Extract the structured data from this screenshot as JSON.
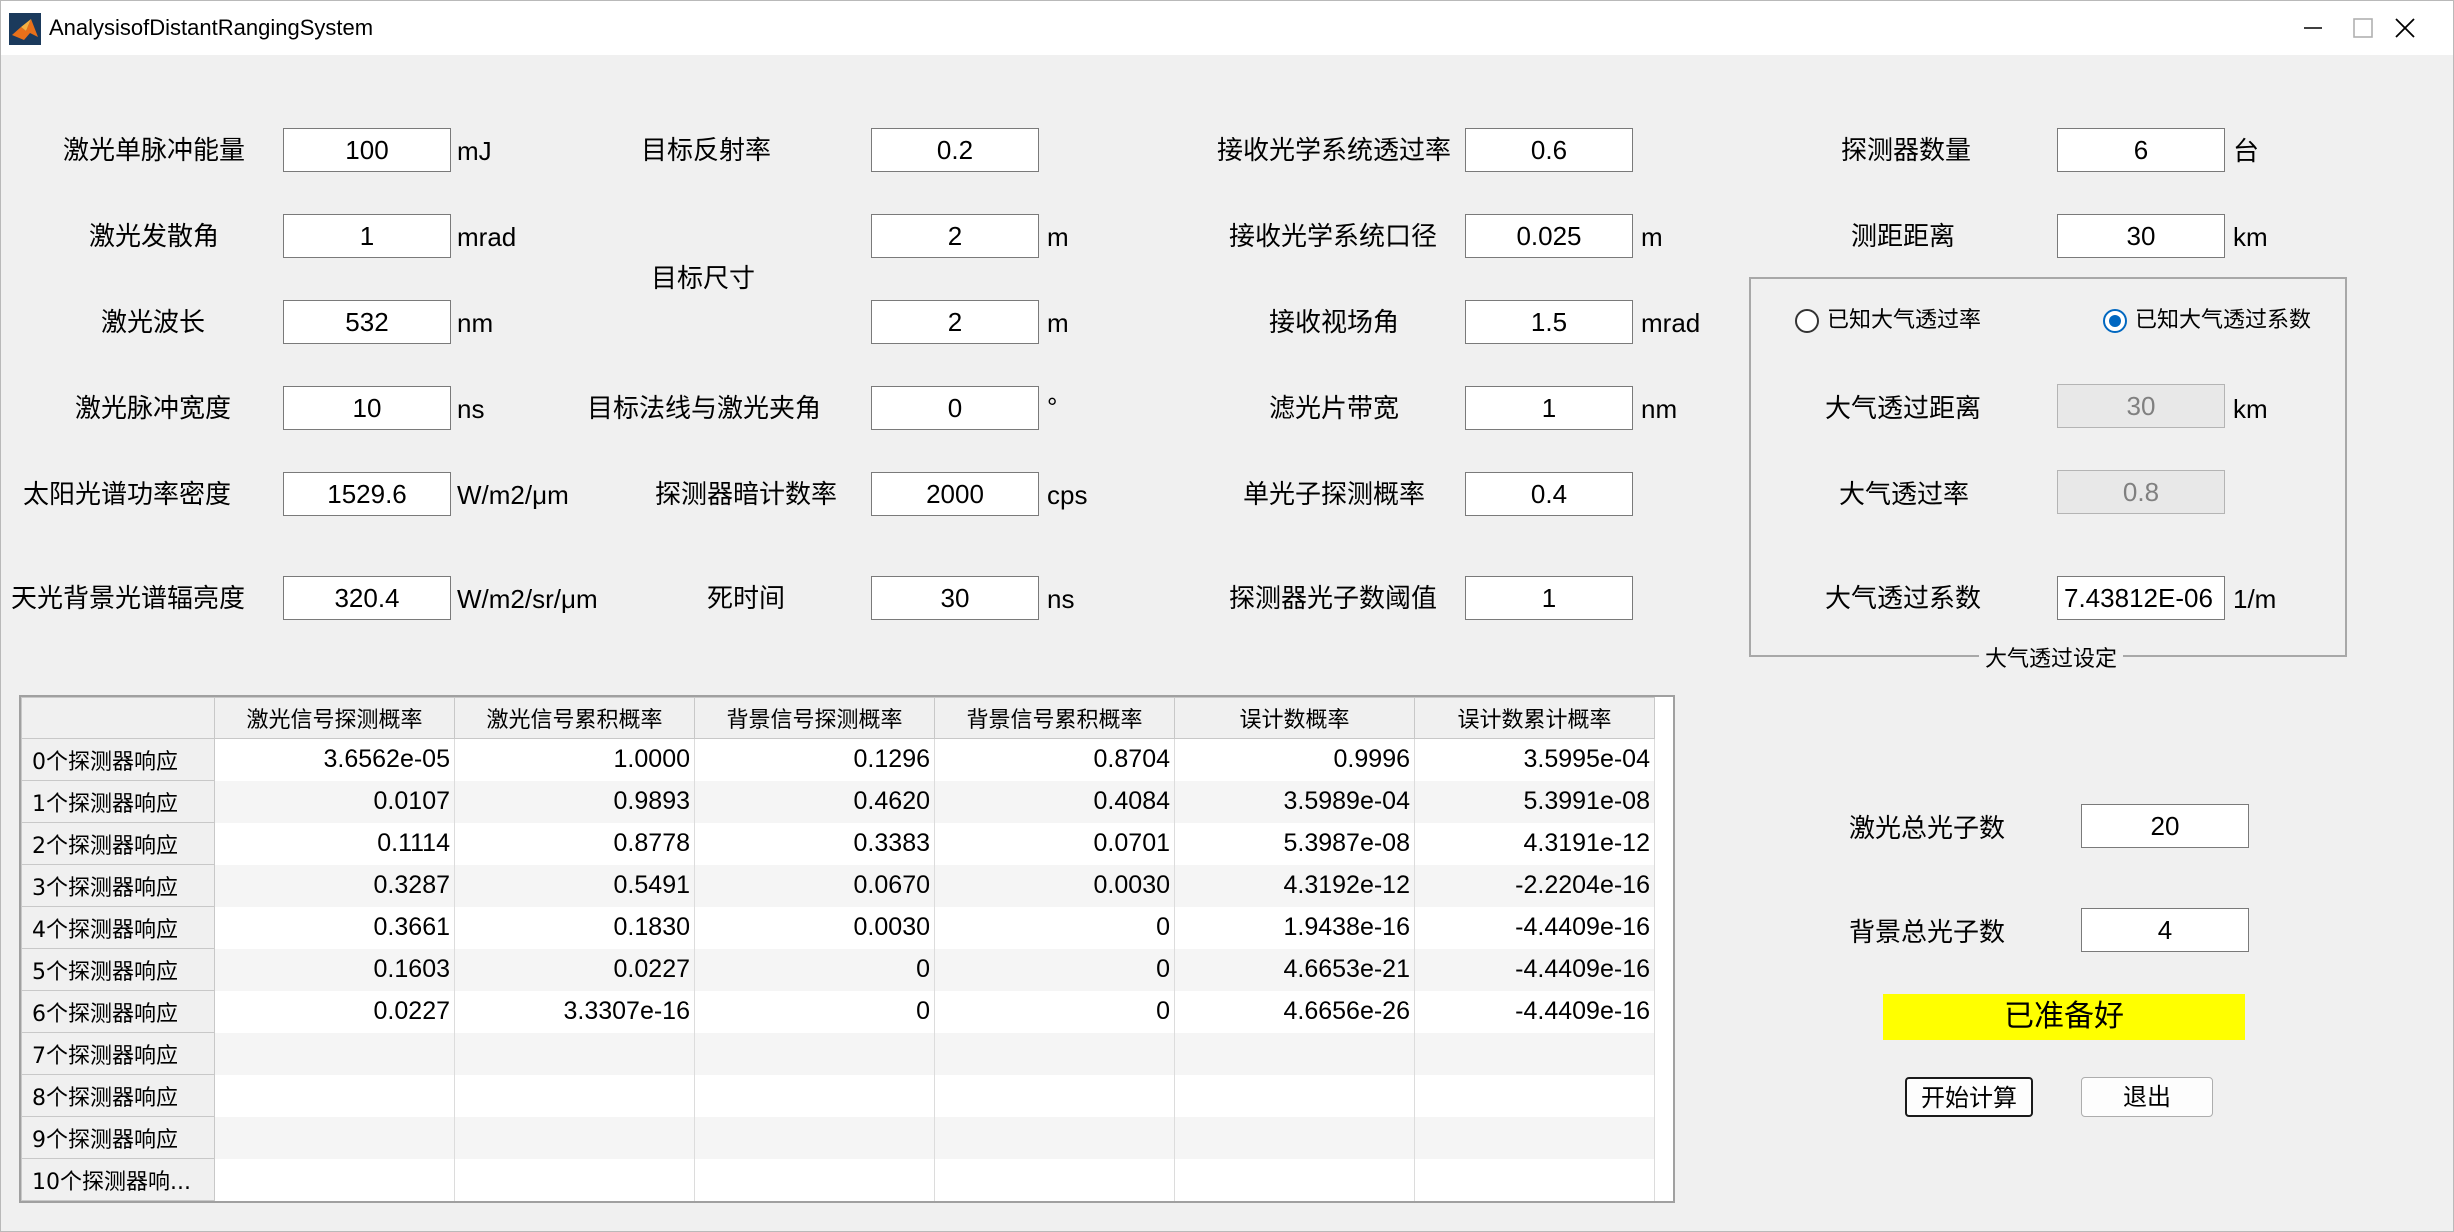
{
  "window": {
    "title": "AnalysisofDistantRangingSystem"
  },
  "params": {
    "laser_energy": {
      "label": "激光单脉冲能量",
      "value": "100",
      "unit": "mJ"
    },
    "divergence": {
      "label": "激光发散角",
      "value": "1",
      "unit": "mrad"
    },
    "wavelength": {
      "label": "激光波长",
      "value": "532",
      "unit": "nm"
    },
    "pulse_width": {
      "label": "激光脉冲宽度",
      "value": "10",
      "unit": "ns"
    },
    "solar_density": {
      "label": "太阳光谱功率密度",
      "value": "1529.6",
      "unit": "W/m2/μm"
    },
    "sky_radiance": {
      "label": "天光背景光谱辐亮度",
      "value": "320.4",
      "unit": "W/m2/sr/μm"
    },
    "target_reflectance": {
      "label": "目标反射率",
      "value": "0.2"
    },
    "target_size": {
      "label": "目标尺寸",
      "value1": "2",
      "unit1": "m",
      "value2": "2",
      "unit2": "m"
    },
    "target_angle": {
      "label": "目标法线与激光夹角",
      "value": "0",
      "unit": "°"
    },
    "dark_count": {
      "label": "探测器暗计数率",
      "value": "2000",
      "unit": "cps"
    },
    "dead_time": {
      "label": "死时间",
      "value": "30",
      "unit": "ns"
    },
    "rx_transmittance": {
      "label": "接收光学系统透过率",
      "value": "0.6"
    },
    "rx_aperture": {
      "label": "接收光学系统口径",
      "value": "0.025",
      "unit": "m"
    },
    "rx_fov": {
      "label": "接收视场角",
      "value": "1.5",
      "unit": "mrad"
    },
    "filter_bw": {
      "label": "滤光片带宽",
      "value": "1",
      "unit": "nm"
    },
    "single_photon_prob": {
      "label": "单光子探测概率",
      "value": "0.4"
    },
    "photon_threshold": {
      "label": "探测器光子数阈值",
      "value": "1"
    },
    "detector_count": {
      "label": "探测器数量",
      "value": "6",
      "unit": "台"
    },
    "range": {
      "label": "测距距离",
      "value": "30",
      "unit": "km"
    }
  },
  "atmosphere": {
    "group_title": "大气透过设定",
    "radio_transmittance": "已知大气透过率",
    "radio_coefficient": "已知大气透过系数",
    "selected": "coefficient",
    "distance": {
      "label": "大气透过距离",
      "value": "30",
      "unit": "km"
    },
    "transmittance": {
      "label": "大气透过率",
      "value": "0.8"
    },
    "coefficient": {
      "label": "大气透过系数",
      "value": "7.43812E-06",
      "unit": "1/m"
    }
  },
  "results_table": {
    "columns": [
      "激光信号探测概率",
      "激光信号累积概率",
      "背景信号探测概率",
      "背景信号累积概率",
      "误计数概率",
      "误计数累计概率"
    ],
    "rows": [
      {
        "head": "0个探测器响应",
        "cells": [
          "3.6562e-05",
          "1.0000",
          "0.1296",
          "0.8704",
          "0.9996",
          "3.5995e-04"
        ]
      },
      {
        "head": "1个探测器响应",
        "cells": [
          "0.0107",
          "0.9893",
          "0.4620",
          "0.4084",
          "3.5989e-04",
          "5.3991e-08"
        ]
      },
      {
        "head": "2个探测器响应",
        "cells": [
          "0.1114",
          "0.8778",
          "0.3383",
          "0.0701",
          "5.3987e-08",
          "4.3191e-12"
        ]
      },
      {
        "head": "3个探测器响应",
        "cells": [
          "0.3287",
          "0.5491",
          "0.0670",
          "0.0030",
          "4.3192e-12",
          "-2.2204e-16"
        ]
      },
      {
        "head": "4个探测器响应",
        "cells": [
          "0.3661",
          "0.1830",
          "0.0030",
          "0",
          "1.9438e-16",
          "-4.4409e-16"
        ]
      },
      {
        "head": "5个探测器响应",
        "cells": [
          "0.1603",
          "0.0227",
          "0",
          "0",
          "4.6653e-21",
          "-4.4409e-16"
        ]
      },
      {
        "head": "6个探测器响应",
        "cells": [
          "0.0227",
          "3.3307e-16",
          "0",
          "0",
          "4.6656e-26",
          "-4.4409e-16"
        ]
      },
      {
        "head": "7个探测器响应",
        "cells": [
          "",
          "",
          "",
          "",
          "",
          ""
        ]
      },
      {
        "head": "8个探测器响应",
        "cells": [
          "",
          "",
          "",
          "",
          "",
          ""
        ]
      },
      {
        "head": "9个探测器响应",
        "cells": [
          "",
          "",
          "",
          "",
          "",
          ""
        ]
      },
      {
        "head": "10个探测器响...",
        "cells": [
          "",
          "",
          "",
          "",
          "",
          ""
        ]
      }
    ]
  },
  "summary": {
    "laser_photons": {
      "label": "激光总光子数",
      "value": "20"
    },
    "background_photons": {
      "label": "背景总光子数",
      "value": "4"
    },
    "status": "已准备好",
    "status_color": "#ffff00"
  },
  "buttons": {
    "start": "开始计算",
    "exit": "退出"
  }
}
